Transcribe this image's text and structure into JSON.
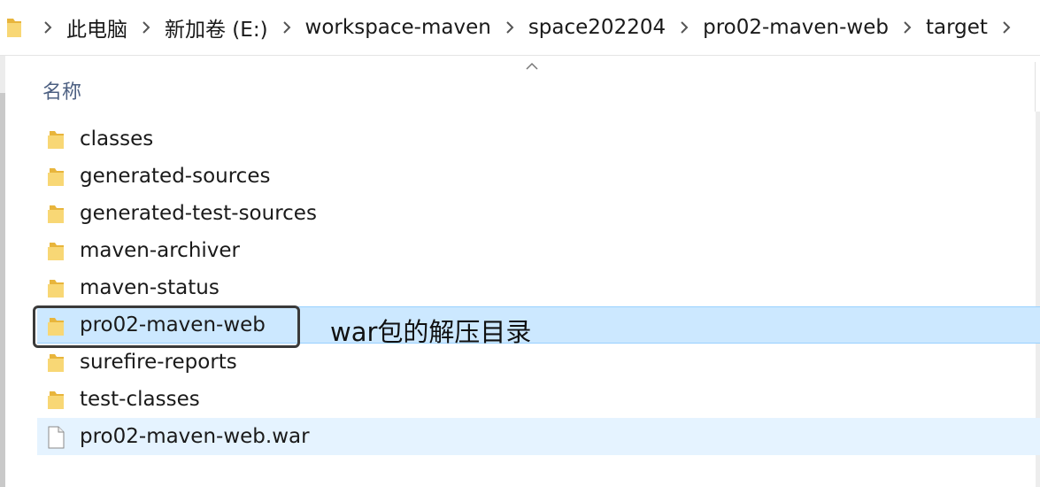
{
  "breadcrumb": {
    "items": [
      "此电脑",
      "新加卷 (E:)",
      "workspace-maven",
      "space202204",
      "pro02-maven-web",
      "target"
    ]
  },
  "list_header": {
    "name_column": "名称"
  },
  "files": [
    {
      "name": "classes",
      "type": "folder",
      "state": "normal"
    },
    {
      "name": "generated-sources",
      "type": "folder",
      "state": "normal"
    },
    {
      "name": "generated-test-sources",
      "type": "folder",
      "state": "normal"
    },
    {
      "name": "maven-archiver",
      "type": "folder",
      "state": "normal"
    },
    {
      "name": "maven-status",
      "type": "folder",
      "state": "normal"
    },
    {
      "name": "pro02-maven-web",
      "type": "folder",
      "state": "selected"
    },
    {
      "name": "surefire-reports",
      "type": "folder",
      "state": "normal"
    },
    {
      "name": "test-classes",
      "type": "folder",
      "state": "normal"
    },
    {
      "name": "pro02-maven-web.war",
      "type": "file",
      "state": "hovered"
    }
  ],
  "annotation": {
    "text": "war包的解压目录"
  },
  "colors": {
    "selected_bg": "#cce8ff",
    "hover_bg": "#e5f3ff",
    "folder_yellow": "#f8d775",
    "header_text": "#4d6082"
  }
}
